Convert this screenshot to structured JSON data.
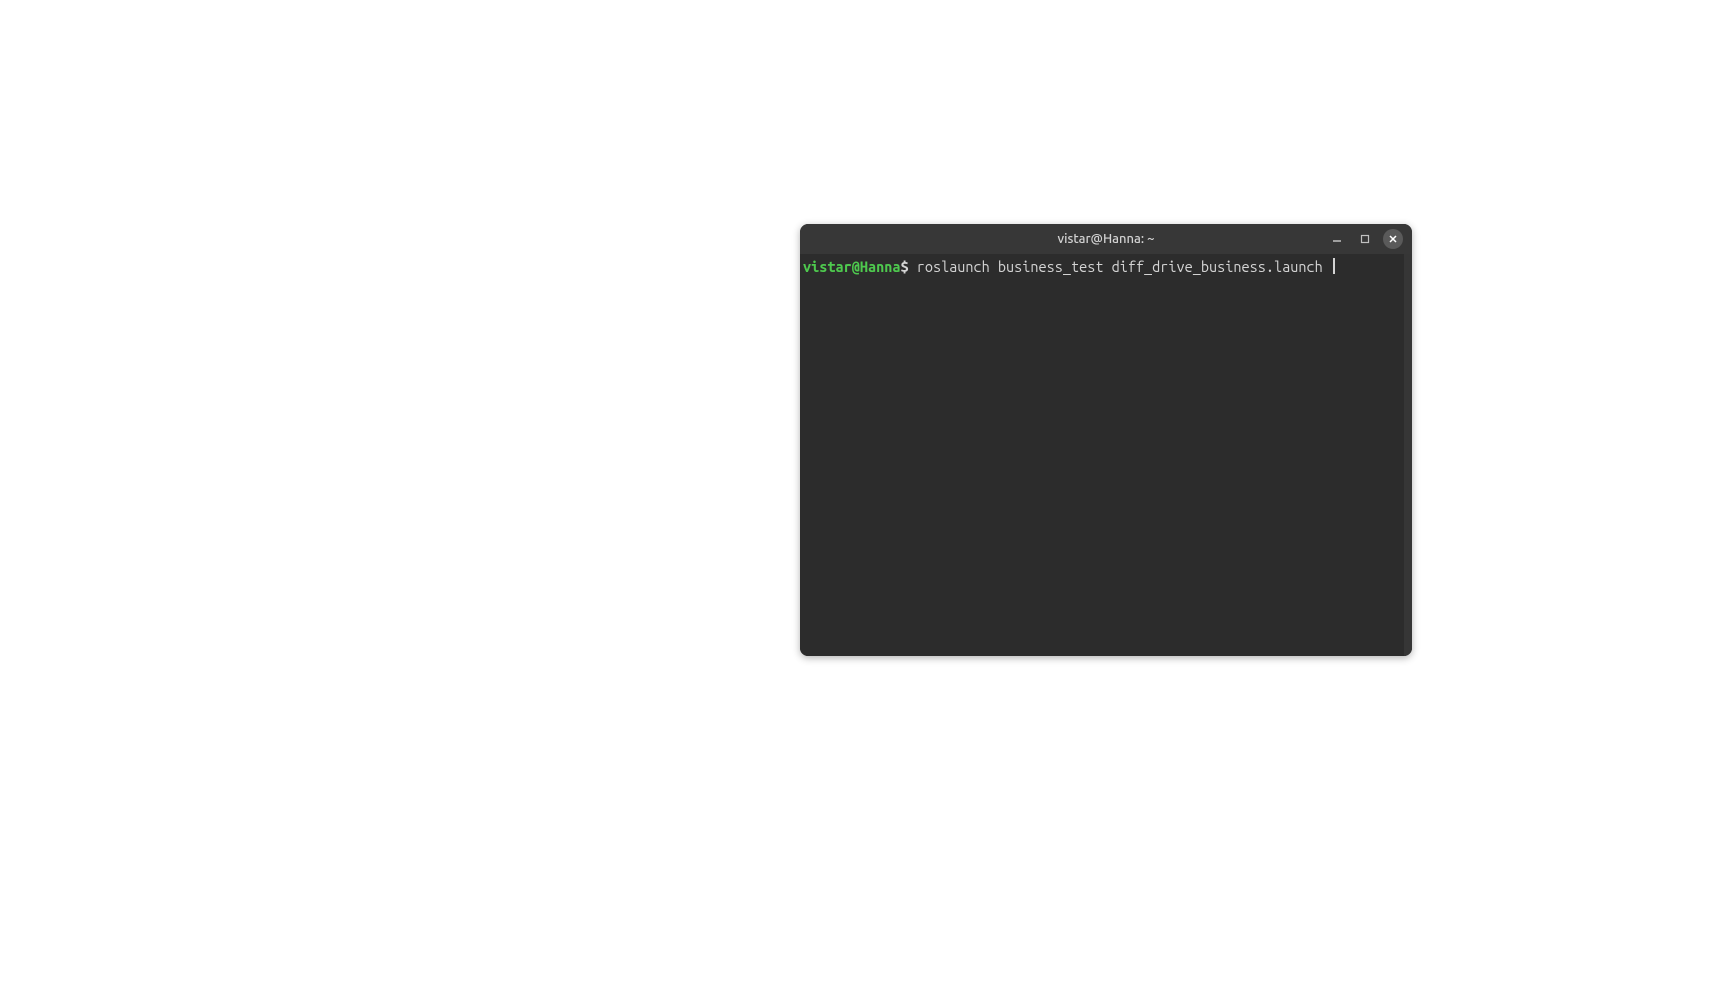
{
  "window": {
    "title": "vistar@Hanna: ~"
  },
  "terminal": {
    "prompt_user_host": "vistar@Hanna",
    "prompt_path": "~",
    "prompt_symbol": "$",
    "command": "roslaunch business_test diff_drive_business.launch "
  },
  "colors": {
    "prompt_green": "#4ec94e",
    "terminal_bg": "#2c2c2c",
    "titlebar_bg": "#373737",
    "text": "#d4d4d4"
  }
}
